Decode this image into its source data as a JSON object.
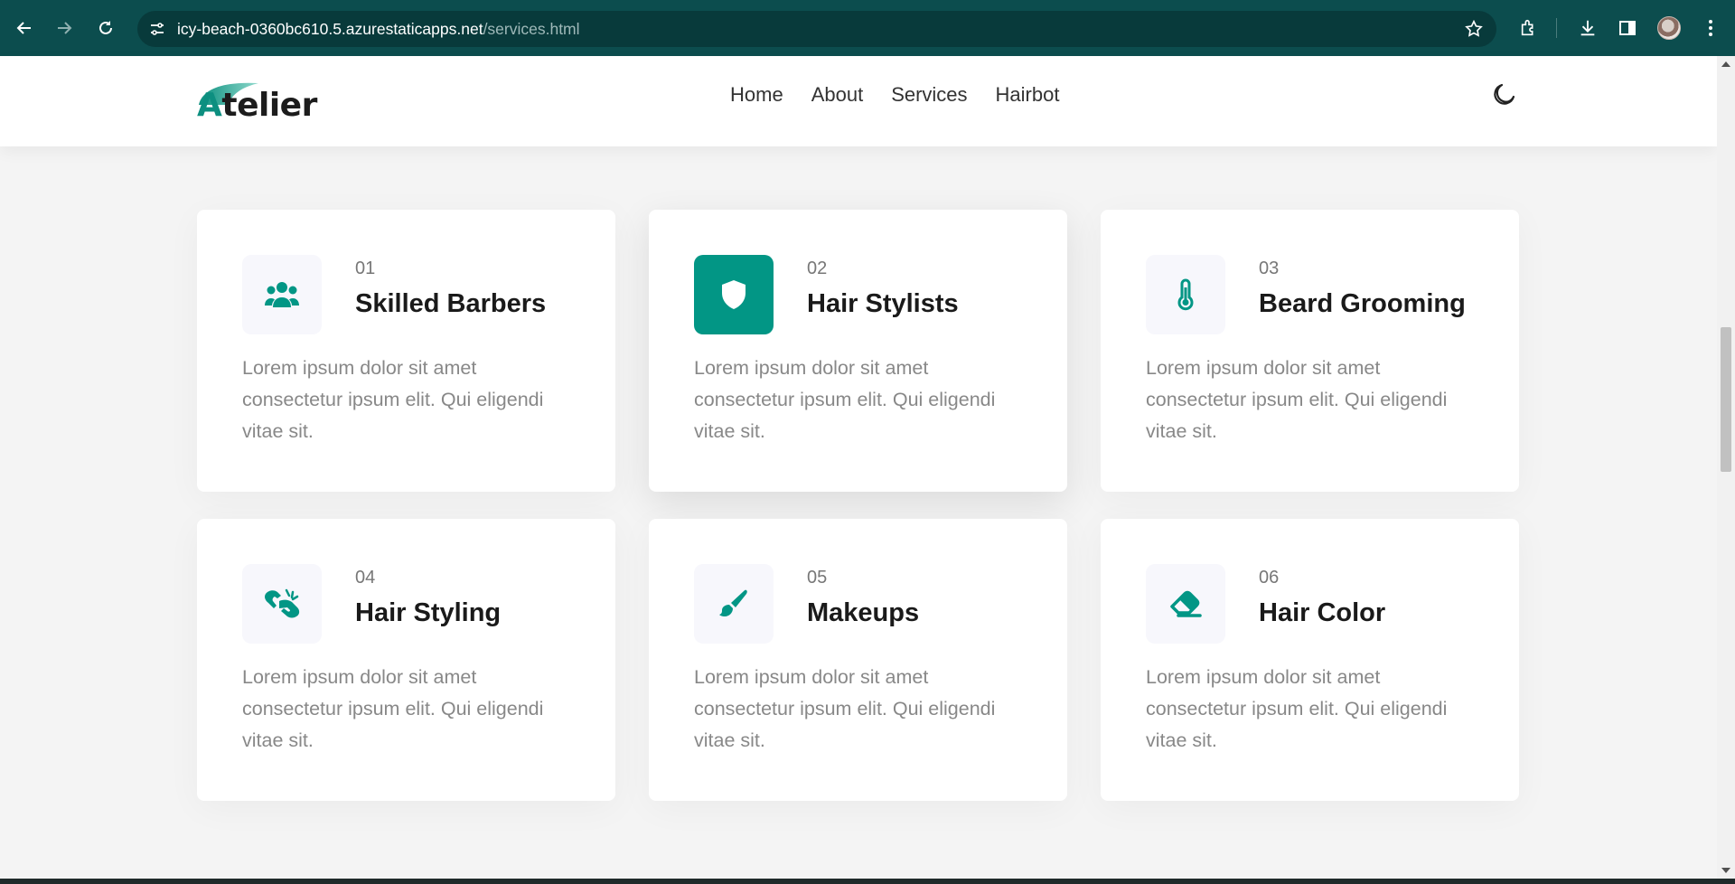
{
  "browser": {
    "url_host": "icy-beach-0360bc610.5.azurestaticapps.net",
    "url_path": "/services.html",
    "icons": [
      "back-icon",
      "forward-icon",
      "reload-icon",
      "site-info-icon",
      "bookmark-star-icon",
      "extensions-icon",
      "download-icon",
      "sidebar-icon",
      "profile-avatar",
      "more-menu-icon"
    ],
    "theme_color": "#0c4d4e"
  },
  "header": {
    "logo_accent": "A",
    "logo_rest": "telier",
    "nav": [
      "Home",
      "About",
      "Services",
      "Hairbot"
    ],
    "theme_toggle_icon": "moon-icon"
  },
  "accent_color": "#029685",
  "services": [
    {
      "num": "01",
      "title": "Skilled Barbers",
      "desc": "Lorem ipsum dolor sit amet consectetur ipsum elit. Qui eligendi vitae sit.",
      "icon": "users-icon",
      "featured": false
    },
    {
      "num": "02",
      "title": "Hair Stylists",
      "desc": "Lorem ipsum dolor sit amet consectetur ipsum elit. Qui eligendi vitae sit.",
      "icon": "shield-icon",
      "featured": true
    },
    {
      "num": "03",
      "title": "Beard Grooming",
      "desc": "Lorem ipsum dolor sit amet consectetur ipsum elit. Qui eligendi vitae sit.",
      "icon": "thermometer-icon",
      "featured": false
    },
    {
      "num": "04",
      "title": "Hair Styling",
      "desc": "Lorem ipsum dolor sit amet consectetur ipsum elit. Qui eligendi vitae sit.",
      "icon": "sign-language-icon",
      "featured": false
    },
    {
      "num": "05",
      "title": "Makeups",
      "desc": "Lorem ipsum dolor sit amet consectetur ipsum elit. Qui eligendi vitae sit.",
      "icon": "paint-brush-icon",
      "featured": false
    },
    {
      "num": "06",
      "title": "Hair Color",
      "desc": "Lorem ipsum dolor sit amet consectetur ipsum elit. Qui eligendi vitae sit.",
      "icon": "eraser-icon",
      "featured": false
    }
  ]
}
